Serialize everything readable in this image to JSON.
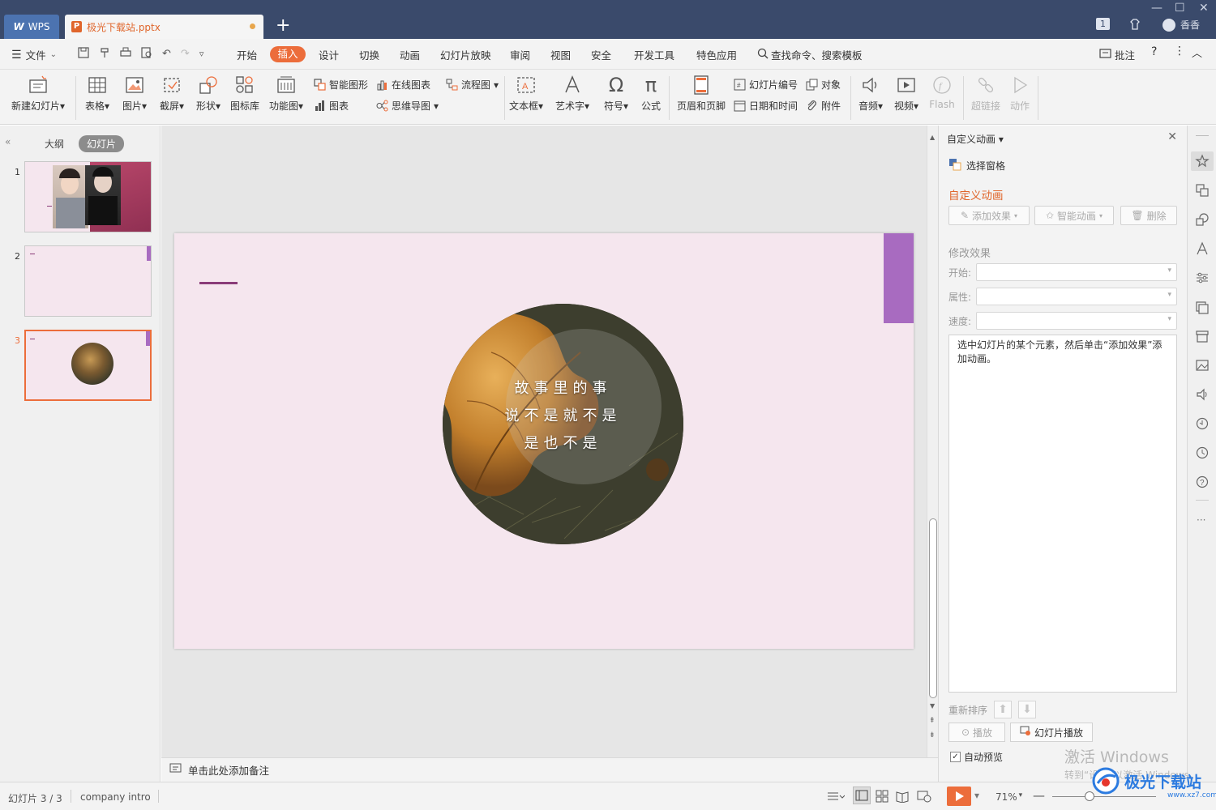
{
  "titlebar": {
    "wps_tab": "WPS",
    "file_tab": "极光下载站.pptx",
    "user_name": "香香",
    "badge": "1"
  },
  "menu": {
    "file": "文件",
    "items": [
      "开始",
      "插入",
      "设计",
      "切换",
      "动画",
      "幻灯片放映",
      "审阅",
      "视图",
      "安全",
      "开发工具",
      "特色应用"
    ],
    "active": "插入",
    "search": "查找命令、搜索模板",
    "comment": "批注",
    "help": "?"
  },
  "ribbon": {
    "new_slide": "新建幻灯片",
    "table": "表格",
    "picture": "图片",
    "screenshot": "截屏",
    "shape": "形状",
    "icon_lib": "图标库",
    "func_chart": "功能图",
    "smart_shape": "智能图形",
    "chart": "图表",
    "online_chart": "在线图表",
    "mindmap": "思维导图",
    "flowchart": "流程图",
    "textbox": "文本框",
    "wordart": "艺术字",
    "symbol": "符号",
    "formula": "公式",
    "header_footer": "页眉和页脚",
    "slide_number": "幻灯片编号",
    "date_time": "日期和时间",
    "object": "对象",
    "attachment": "附件",
    "audio": "音频",
    "video": "视频",
    "flash": "Flash",
    "hyperlink": "超链接",
    "action": "动作"
  },
  "leftpanel": {
    "outline_tab": "大纲",
    "slides_tab": "幻灯片",
    "slides": [
      "1",
      "2",
      "3"
    ]
  },
  "slide": {
    "line1": "故事里的事",
    "line2": "说不是就不是",
    "line3": "是也不是"
  },
  "notes": {
    "placeholder": "单击此处添加备注"
  },
  "rightpanel": {
    "title": "自定义动画",
    "select_pane": "选择窗格",
    "heading": "自定义动画",
    "add_effect": "添加效果",
    "smart_anim": "智能动画",
    "delete": "删除",
    "modify": "修改效果",
    "start_label": "开始:",
    "prop_label": "属性:",
    "speed_label": "速度:",
    "hint": "选中幻灯片的某个元素，然后单击“添加效果”添加动画。",
    "reorder": "重新排序",
    "play": "播放",
    "slideshow": "幻灯片播放",
    "auto_preview": "自动预览"
  },
  "statusbar": {
    "slide_info": "幻灯片 3 / 3",
    "theme": "company intro",
    "zoom": "71%"
  },
  "watermark": {
    "line1": "激活 Windows",
    "line2": "转到“设置”以激活 Windows。",
    "site": "极光下载站",
    "site_url": "www.xz7.com"
  },
  "colors": {
    "accent": "#ec6d3b",
    "titlebar": "#3a4a6b",
    "slide_bg": "#f5e6ee",
    "purple": "#a86bc0"
  }
}
